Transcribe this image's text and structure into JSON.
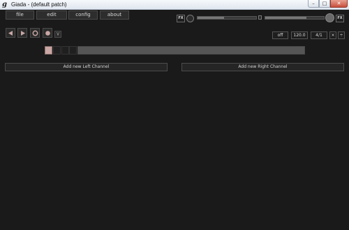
{
  "window": {
    "title": "Giada - (default patch)",
    "app_icon_glyph": "g",
    "minimize_glyph": "–",
    "maximize_glyph": "□",
    "close_glyph": "✕"
  },
  "menu": {
    "file": "file",
    "edit": "edit",
    "config": "config",
    "about": "about"
  },
  "master": {
    "fx_in_label": "FX",
    "fx_out_label": "FX",
    "input_meter_level": 0.45,
    "output_meter_level": 0.7
  },
  "transport": {
    "rewind_icon": "rewind-icon",
    "play_icon": "play-icon",
    "record_actions_icon": "record-actions-icon",
    "record_input_icon": "record-input-icon",
    "metronome_label": "\\/"
  },
  "timing": {
    "quantize": "off",
    "bpm": "120.0",
    "meter": "4/1",
    "beats_divide": "×",
    "beats_multiply": "÷"
  },
  "beats": {
    "total": 4,
    "current": 1
  },
  "channels": {
    "add_left": "Add new Left Channel",
    "add_right": "Add new Right Channel"
  },
  "colors": {
    "background": "#1a1a1a",
    "active_beat": "#c9a7a4",
    "button_border": "#4c4c4c"
  }
}
